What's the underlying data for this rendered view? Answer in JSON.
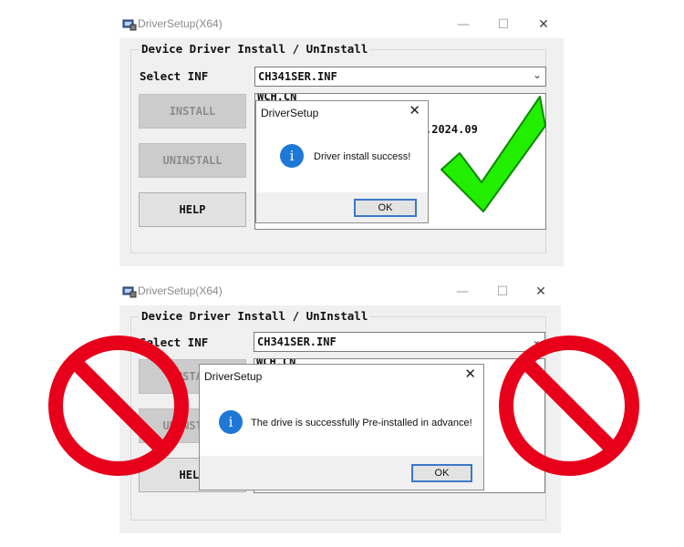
{
  "top_window": {
    "title": "DriverSetup(X64)",
    "controls": {
      "minimize": "—",
      "maximize": "☐",
      "close": "✕"
    },
    "group_label": "Device Driver Install / UnInstall",
    "select_label": "Select INF",
    "inf_value": "CH341SER.INF",
    "buttons": {
      "install": "INSTALL",
      "uninstall": "UNINSTALL",
      "help": "HELP"
    },
    "info_lines": [
      "WCH.CN",
      ".2024.09"
    ],
    "dialog": {
      "title": "DriverSetup",
      "close": "✕",
      "icon": "i",
      "message": "Driver install success!",
      "ok": "OK"
    }
  },
  "bottom_window": {
    "title": "DriverSetup(X64)",
    "controls": {
      "minimize": "—",
      "maximize": "☐",
      "close": "✕"
    },
    "group_label": "Device Driver Install / UnInstall",
    "select_label": "Select INF",
    "inf_value": "CH341SER.INF",
    "buttons": {
      "install": "INSTALL",
      "uninstall": "UNINSTALL",
      "help": "HELP"
    },
    "info_lines": [
      "WCH.CN"
    ],
    "dialog": {
      "title": "DriverSetup",
      "close": "✕",
      "icon": "i",
      "message": "The drive is successfully Pre-installed in advance!",
      "ok": "OK"
    }
  },
  "overlays": {
    "success_mark": "green-checkmark-icon",
    "prohibited_mark": "red-prohibited-icon",
    "colors": {
      "check": "#22ee00",
      "prohibited": "#e8001a",
      "info_icon": "#1e78d7"
    }
  }
}
